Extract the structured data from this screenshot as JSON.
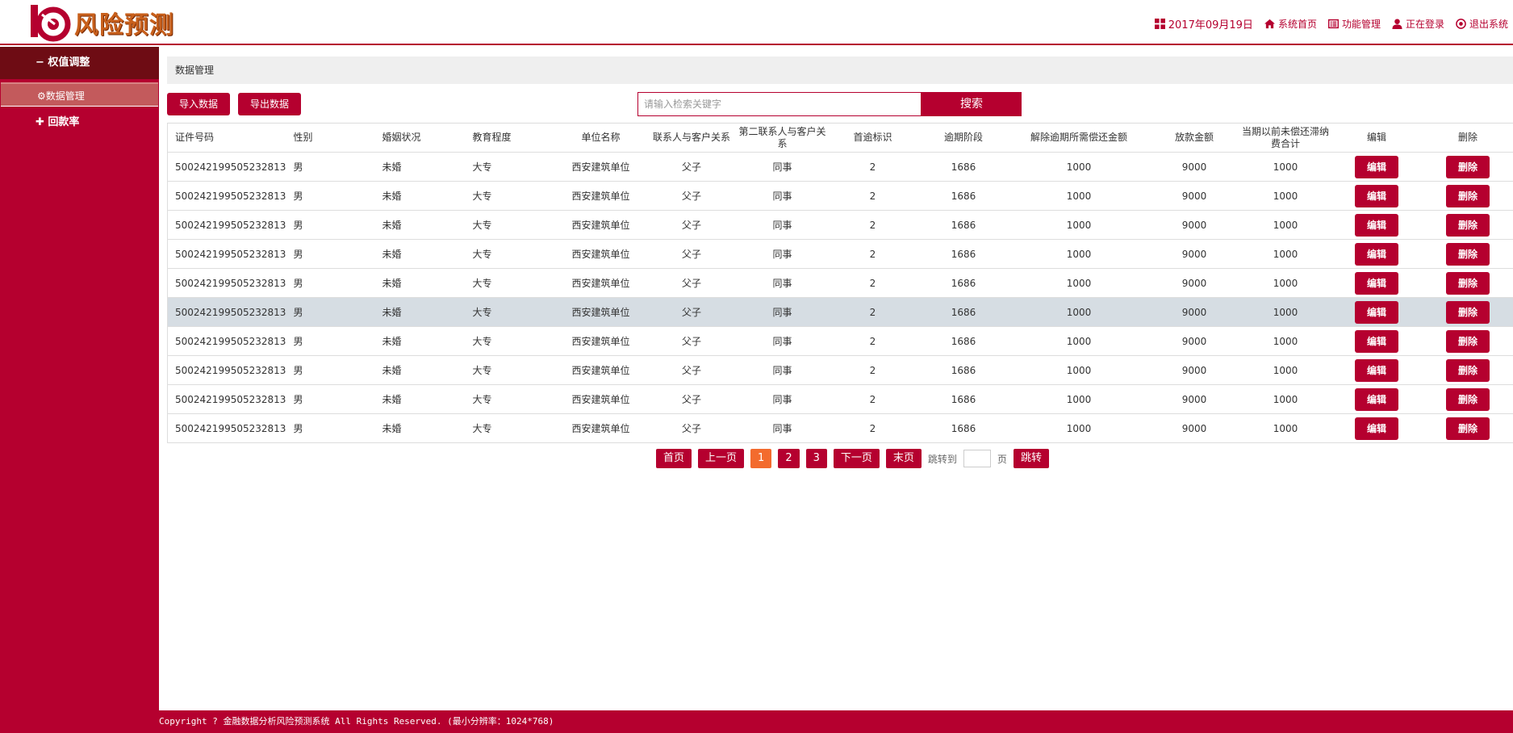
{
  "header": {
    "logo_text": "风险预测",
    "nav": [
      {
        "icon": "grid-icon",
        "label": "2017年09月19日"
      },
      {
        "icon": "home-icon",
        "label": "系统首页"
      },
      {
        "icon": "list-icon",
        "label": "功能管理"
      },
      {
        "icon": "user-icon",
        "label": "正在登录"
      },
      {
        "icon": "power-icon",
        "label": "退出系统"
      }
    ]
  },
  "sidebar": {
    "groups": [
      {
        "prefix": "− ",
        "label": "权值调整"
      },
      {
        "prefix": "✚ ",
        "label": "回款率"
      }
    ],
    "active_item": {
      "prefix": "⚙",
      "label": "数据管理"
    }
  },
  "main": {
    "title": "数据管理",
    "import_label": "导入数据",
    "export_label": "导出数据",
    "search_placeholder": "请输入检索关键字",
    "search_label": "搜索"
  },
  "table": {
    "headers": [
      "证件号码",
      "性别",
      "婚姻状况",
      "教育程度",
      "单位名称",
      "联系人与客户关系",
      "第二联系人与客户关系",
      "首逾标识",
      "逾期阶段",
      "解除逾期所需偿还金额",
      "放款金额",
      "当期以前未偿还滞纳费合计",
      "编辑",
      "删除"
    ],
    "edit_label": "编辑",
    "delete_label": "删除",
    "rows": [
      [
        "500242199505232813",
        "男",
        "未婚",
        "大专",
        "西安建筑单位",
        "父子",
        "同事",
        "2",
        "1686",
        "1000",
        "9000",
        "1000"
      ],
      [
        "500242199505232813",
        "男",
        "未婚",
        "大专",
        "西安建筑单位",
        "父子",
        "同事",
        "2",
        "1686",
        "1000",
        "9000",
        "1000"
      ],
      [
        "500242199505232813",
        "男",
        "未婚",
        "大专",
        "西安建筑单位",
        "父子",
        "同事",
        "2",
        "1686",
        "1000",
        "9000",
        "1000"
      ],
      [
        "500242199505232813",
        "男",
        "未婚",
        "大专",
        "西安建筑单位",
        "父子",
        "同事",
        "2",
        "1686",
        "1000",
        "9000",
        "1000"
      ],
      [
        "500242199505232813",
        "男",
        "未婚",
        "大专",
        "西安建筑单位",
        "父子",
        "同事",
        "2",
        "1686",
        "1000",
        "9000",
        "1000"
      ],
      [
        "500242199505232813",
        "男",
        "未婚",
        "大专",
        "西安建筑单位",
        "父子",
        "同事",
        "2",
        "1686",
        "1000",
        "9000",
        "1000"
      ],
      [
        "500242199505232813",
        "男",
        "未婚",
        "大专",
        "西安建筑单位",
        "父子",
        "同事",
        "2",
        "1686",
        "1000",
        "9000",
        "1000"
      ],
      [
        "500242199505232813",
        "男",
        "未婚",
        "大专",
        "西安建筑单位",
        "父子",
        "同事",
        "2",
        "1686",
        "1000",
        "9000",
        "1000"
      ],
      [
        "500242199505232813",
        "男",
        "未婚",
        "大专",
        "西安建筑单位",
        "父子",
        "同事",
        "2",
        "1686",
        "1000",
        "9000",
        "1000"
      ],
      [
        "500242199505232813",
        "男",
        "未婚",
        "大专",
        "西安建筑单位",
        "父子",
        "同事",
        "2",
        "1686",
        "1000",
        "9000",
        "1000"
      ]
    ],
    "highlight_row": 5
  },
  "pager": {
    "first": "首页",
    "prev": "上一页",
    "pages": [
      "1",
      "2",
      "3"
    ],
    "current": "1",
    "next": "下一页",
    "last": "末页",
    "goto_prefix": "跳转到",
    "goto_suffix": "页",
    "goto_button": "跳转"
  },
  "footer": {
    "text": "Copyright ? 金融数据分析风险预测系统 All Rights Reserved. (最小分辨率：1024*768)"
  },
  "colors": {
    "primary": "#b5002f",
    "sidebar_active_group": "#6e0c14",
    "sidebar_item": "#c35a5c",
    "pager_current": "#f36b2e",
    "row_highlight": "#d6dde3"
  }
}
